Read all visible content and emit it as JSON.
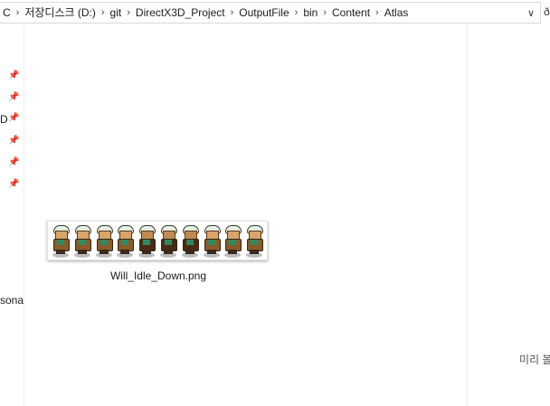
{
  "address_bar": {
    "crumbs": [
      "C",
      "저장디스크 (D:)",
      "git",
      "DirectX3D_Project",
      "OutputFile",
      "bin",
      "Content",
      "Atlas"
    ],
    "separator": "›",
    "dropdown": "∨",
    "right_fragment": "ð"
  },
  "nav_pane": {
    "pin_glyph": "📌",
    "d_fragment": "D",
    "persona_fragment": "sona"
  },
  "files": [
    {
      "name": "Will_Idle_Down.png",
      "frames": 10
    }
  ],
  "preview_pane": {
    "message": "미리 볼"
  }
}
